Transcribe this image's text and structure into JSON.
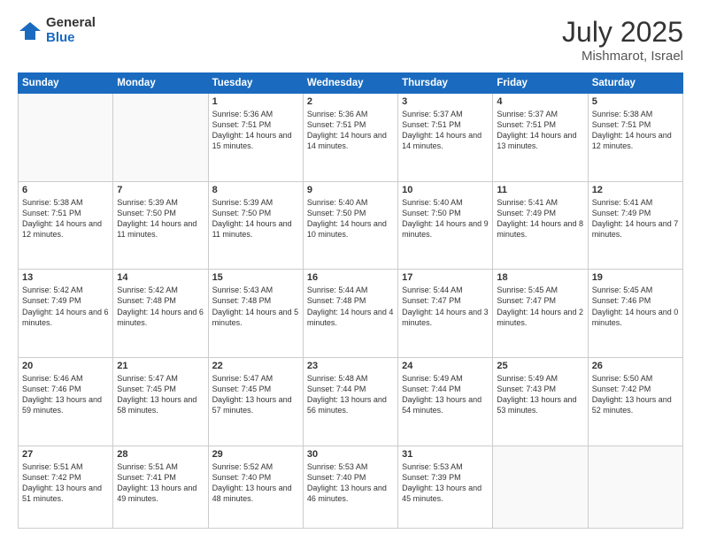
{
  "logo": {
    "general": "General",
    "blue": "Blue"
  },
  "title": {
    "month": "July 2025",
    "location": "Mishmarot, Israel"
  },
  "weekdays": [
    "Sunday",
    "Monday",
    "Tuesday",
    "Wednesday",
    "Thursday",
    "Friday",
    "Saturday"
  ],
  "days": [
    {
      "day": "",
      "info": ""
    },
    {
      "day": "",
      "info": ""
    },
    {
      "day": "1",
      "info": "Sunrise: 5:36 AM\nSunset: 7:51 PM\nDaylight: 14 hours and 15 minutes."
    },
    {
      "day": "2",
      "info": "Sunrise: 5:36 AM\nSunset: 7:51 PM\nDaylight: 14 hours and 14 minutes."
    },
    {
      "day": "3",
      "info": "Sunrise: 5:37 AM\nSunset: 7:51 PM\nDaylight: 14 hours and 14 minutes."
    },
    {
      "day": "4",
      "info": "Sunrise: 5:37 AM\nSunset: 7:51 PM\nDaylight: 14 hours and 13 minutes."
    },
    {
      "day": "5",
      "info": "Sunrise: 5:38 AM\nSunset: 7:51 PM\nDaylight: 14 hours and 12 minutes."
    },
    {
      "day": "6",
      "info": "Sunrise: 5:38 AM\nSunset: 7:51 PM\nDaylight: 14 hours and 12 minutes."
    },
    {
      "day": "7",
      "info": "Sunrise: 5:39 AM\nSunset: 7:50 PM\nDaylight: 14 hours and 11 minutes."
    },
    {
      "day": "8",
      "info": "Sunrise: 5:39 AM\nSunset: 7:50 PM\nDaylight: 14 hours and 11 minutes."
    },
    {
      "day": "9",
      "info": "Sunrise: 5:40 AM\nSunset: 7:50 PM\nDaylight: 14 hours and 10 minutes."
    },
    {
      "day": "10",
      "info": "Sunrise: 5:40 AM\nSunset: 7:50 PM\nDaylight: 14 hours and 9 minutes."
    },
    {
      "day": "11",
      "info": "Sunrise: 5:41 AM\nSunset: 7:49 PM\nDaylight: 14 hours and 8 minutes."
    },
    {
      "day": "12",
      "info": "Sunrise: 5:41 AM\nSunset: 7:49 PM\nDaylight: 14 hours and 7 minutes."
    },
    {
      "day": "13",
      "info": "Sunrise: 5:42 AM\nSunset: 7:49 PM\nDaylight: 14 hours and 6 minutes."
    },
    {
      "day": "14",
      "info": "Sunrise: 5:42 AM\nSunset: 7:48 PM\nDaylight: 14 hours and 6 minutes."
    },
    {
      "day": "15",
      "info": "Sunrise: 5:43 AM\nSunset: 7:48 PM\nDaylight: 14 hours and 5 minutes."
    },
    {
      "day": "16",
      "info": "Sunrise: 5:44 AM\nSunset: 7:48 PM\nDaylight: 14 hours and 4 minutes."
    },
    {
      "day": "17",
      "info": "Sunrise: 5:44 AM\nSunset: 7:47 PM\nDaylight: 14 hours and 3 minutes."
    },
    {
      "day": "18",
      "info": "Sunrise: 5:45 AM\nSunset: 7:47 PM\nDaylight: 14 hours and 2 minutes."
    },
    {
      "day": "19",
      "info": "Sunrise: 5:45 AM\nSunset: 7:46 PM\nDaylight: 14 hours and 0 minutes."
    },
    {
      "day": "20",
      "info": "Sunrise: 5:46 AM\nSunset: 7:46 PM\nDaylight: 13 hours and 59 minutes."
    },
    {
      "day": "21",
      "info": "Sunrise: 5:47 AM\nSunset: 7:45 PM\nDaylight: 13 hours and 58 minutes."
    },
    {
      "day": "22",
      "info": "Sunrise: 5:47 AM\nSunset: 7:45 PM\nDaylight: 13 hours and 57 minutes."
    },
    {
      "day": "23",
      "info": "Sunrise: 5:48 AM\nSunset: 7:44 PM\nDaylight: 13 hours and 56 minutes."
    },
    {
      "day": "24",
      "info": "Sunrise: 5:49 AM\nSunset: 7:44 PM\nDaylight: 13 hours and 54 minutes."
    },
    {
      "day": "25",
      "info": "Sunrise: 5:49 AM\nSunset: 7:43 PM\nDaylight: 13 hours and 53 minutes."
    },
    {
      "day": "26",
      "info": "Sunrise: 5:50 AM\nSunset: 7:42 PM\nDaylight: 13 hours and 52 minutes."
    },
    {
      "day": "27",
      "info": "Sunrise: 5:51 AM\nSunset: 7:42 PM\nDaylight: 13 hours and 51 minutes."
    },
    {
      "day": "28",
      "info": "Sunrise: 5:51 AM\nSunset: 7:41 PM\nDaylight: 13 hours and 49 minutes."
    },
    {
      "day": "29",
      "info": "Sunrise: 5:52 AM\nSunset: 7:40 PM\nDaylight: 13 hours and 48 minutes."
    },
    {
      "day": "30",
      "info": "Sunrise: 5:53 AM\nSunset: 7:40 PM\nDaylight: 13 hours and 46 minutes."
    },
    {
      "day": "31",
      "info": "Sunrise: 5:53 AM\nSunset: 7:39 PM\nDaylight: 13 hours and 45 minutes."
    },
    {
      "day": "",
      "info": ""
    },
    {
      "day": "",
      "info": ""
    },
    {
      "day": "",
      "info": ""
    }
  ]
}
